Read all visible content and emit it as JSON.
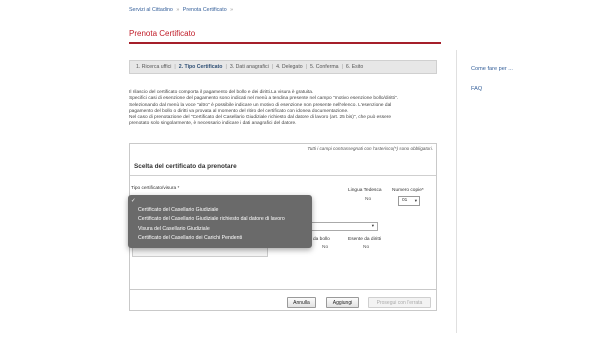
{
  "breadcrumb": {
    "items": [
      "Servizi al Cittadino",
      "Prenota Certificato"
    ],
    "separator": "»"
  },
  "page": {
    "title": "Prenota Certificato"
  },
  "steps": [
    {
      "label": "1. Ricerca uffici",
      "active": false
    },
    {
      "label": "2. Tipo Certificato",
      "active": true
    },
    {
      "label": "3. Dati anagrafici",
      "active": false
    },
    {
      "label": "4. Delegato",
      "active": false
    },
    {
      "label": "5. Conferma",
      "active": false
    },
    {
      "label": "6. Esito",
      "active": false
    }
  ],
  "steps_separator": "|",
  "intro": [
    "Il rilascio del certificato comporta il pagamento del bollo e dei diritti.La visura è gratuita.",
    "Specifici casi di esenzione del pagamento sono indicati nel menù a tendina presente nel campo \"motivo esenzione bollo/diritti\".",
    "Selezionando dal menù la voce \"altro\" è possibile indicare un motivo di esenzione non presente nell'elenco. L'esenzione dal",
    "pagamento del bollo o diritti va provata al momento del ritiro del certificato con idonea documentazione.",
    "Nel caso di prenotazione del \"Certificato del Casellario Giudiziale richiesto dal datore di lavoro (art. 25 bis)\", che può essere",
    "prenotato solo singolarmente, è necessario indicare i dati anagrafici del datore."
  ],
  "form": {
    "required_note": "Tutti i campi contrassegnati con l'asterisco(*) sono obbligatori.",
    "section_title": "Scelta del certificato da prenotare",
    "tipo_label": "Tipo certificato/visura *",
    "lingua_label": "Lingua Tedesca",
    "lingua_value": "No",
    "copie_label": "Numero copie*",
    "copie_value": "01",
    "bollo_label": "Esente da bollo",
    "bollo_label_visible": "nte da bollo",
    "bollo_value": "No",
    "diritti_label": "Esente da diritti",
    "diritti_value": "No"
  },
  "dropdown": {
    "options": [
      {
        "label": "",
        "checked": true
      },
      {
        "label": "Certificato del Casellario Giudiziale",
        "checked": false
      },
      {
        "label": "Certificato del Casellario Giudiziale richiesto dal datore di lavoro",
        "checked": false
      },
      {
        "label": "Visura del Casellario Giudiziale",
        "checked": false
      },
      {
        "label": "Certificato del Casellario dei Carichi Pendenti",
        "checked": false
      }
    ],
    "check_glyph": "✓"
  },
  "buttons": {
    "annulla": "Annulla",
    "aggiungi": "Aggiungi",
    "prosegui": "Prosegui con l'errata"
  },
  "sidebar": {
    "links": [
      "Come fare per ...",
      "FAQ"
    ]
  },
  "colors": {
    "accent_red": "#a51f2a",
    "title_red": "#c01c28",
    "link_blue": "#345f9a",
    "dropdown_bg": "#6a6a6a"
  }
}
